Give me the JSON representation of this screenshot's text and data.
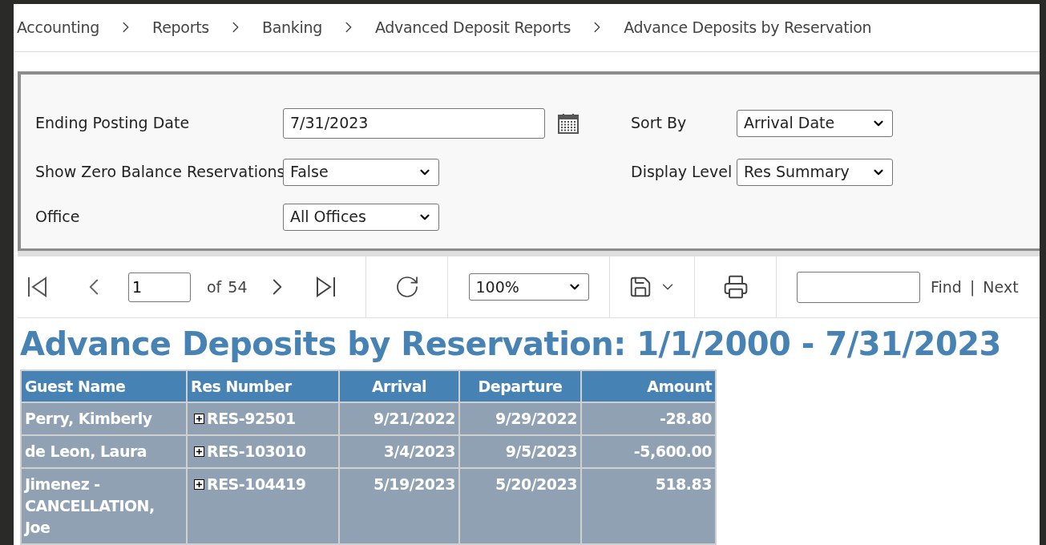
{
  "breadcrumb": [
    {
      "label": "Accounting"
    },
    {
      "label": "Reports"
    },
    {
      "label": "Banking"
    },
    {
      "label": "Advanced Deposit Reports"
    },
    {
      "label": "Advance Deposits by Reservation"
    }
  ],
  "parameters": {
    "left": [
      {
        "kind": "date",
        "label": "Ending Posting Date",
        "value": "7/31/2023"
      },
      {
        "kind": "select",
        "label": "Show Zero Balance Reservations",
        "value": "False"
      },
      {
        "kind": "select",
        "label": "Office",
        "value": "All Offices"
      }
    ],
    "right": [
      {
        "kind": "select",
        "label": "Sort By",
        "value": "Arrival Date"
      },
      {
        "kind": "select",
        "label": "Display Level",
        "value": "Res Summary"
      }
    ]
  },
  "toolbar": {
    "page": "1",
    "of_label": "of",
    "page_count": "54",
    "zoom": "100%",
    "find_label": "Find",
    "separator": "|",
    "next_label": "Next"
  },
  "report": {
    "title": "Advance Deposits by Reservation: 1/1/2000 - 7/31/2023",
    "columns": [
      {
        "label": "Guest Name"
      },
      {
        "label": "Res Number"
      },
      {
        "label": "Arrival"
      },
      {
        "label": "Departure"
      },
      {
        "label": "Amount"
      }
    ],
    "rows": [
      {
        "guest": "Perry, Kimberly",
        "res": "RES-92501",
        "arrival": "9/21/2022",
        "departure": "9/29/2022",
        "amount": "-28.80"
      },
      {
        "guest": "de Leon, Laura",
        "res": "RES-103010",
        "arrival": "3/4/2023",
        "departure": "9/5/2023",
        "amount": "-5,600.00"
      },
      {
        "guest": "Jimenez - CANCELLATION, Joe",
        "res": "RES-104419",
        "arrival": "5/19/2023",
        "departure": "5/20/2023",
        "amount": "518.83"
      }
    ]
  }
}
